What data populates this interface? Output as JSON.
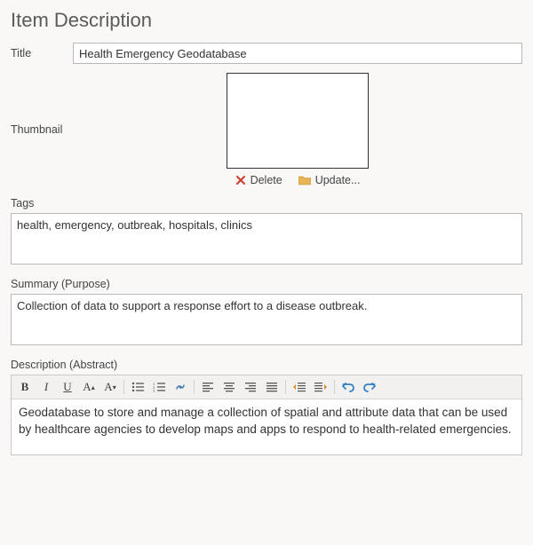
{
  "header": {
    "title": "Item Description"
  },
  "title_field": {
    "label": "Title",
    "value": "Health Emergency Geodatabase"
  },
  "thumbnail": {
    "label": "Thumbnail",
    "delete_label": "Delete",
    "update_label": "Update..."
  },
  "tags": {
    "label": "Tags",
    "value": "health, emergency, outbreak, hospitals, clinics"
  },
  "summary": {
    "label": "Summary (Purpose)",
    "value": "Collection of data to support a response effort to a disease outbreak."
  },
  "description": {
    "label": "Description (Abstract)",
    "value": "Geodatabase to store and manage a collection of spatial and attribute data that can be used by healthcare agencies to develop maps and apps to respond to health-related emergencies."
  },
  "toolbar": {
    "bold": "B",
    "italic": "I",
    "underline": "U",
    "grow": "A",
    "shrink": "A"
  }
}
